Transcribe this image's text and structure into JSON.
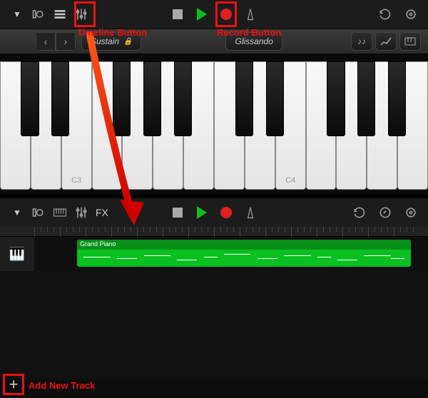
{
  "annotations": {
    "timeline_button": "Timeline Button",
    "record_button": "Record Button",
    "add_new_track": "Add New Track"
  },
  "top_view": {
    "controls": {
      "sustain": "Sustain",
      "glissando": "Glissando"
    },
    "keyboard": {
      "white_key_count": 14,
      "labels": {
        "c3": "C3",
        "c4": "C4"
      },
      "black_key_positions_pct": [
        4.9,
        12.05,
        26.35,
        33.5,
        40.65,
        54.95,
        62.1,
        76.4,
        83.55,
        90.7
      ]
    }
  },
  "bottom_view": {
    "fx_label": "FX",
    "track": {
      "region_name": "Grand Piano",
      "instrument_icon": "grand-piano"
    }
  },
  "transport": {
    "stop": "stop",
    "play": "play",
    "record": "record"
  },
  "colors": {
    "highlight": "#ee1111",
    "play_green": "#0ac020",
    "record_red": "#e02020",
    "region_green": "#0ac020"
  }
}
